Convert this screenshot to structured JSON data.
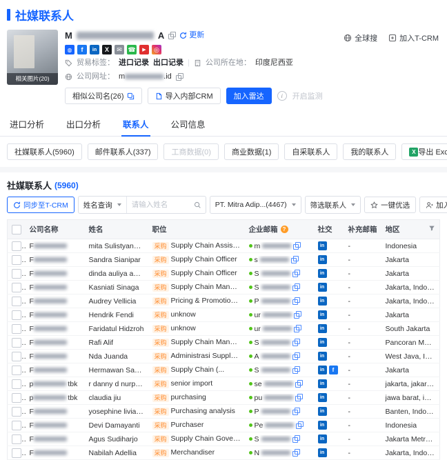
{
  "colors": {
    "primary": "#1665ff",
    "tag_orange": "#ff8a2b",
    "linkedin_blue": "#0a66c2",
    "facebook_blue": "#1877f2",
    "excel_green": "#21a366",
    "status_dot_green": "#52c41a"
  },
  "page": {
    "title": "社媒联系人"
  },
  "header_links": {
    "global_search": "全球搜",
    "join_tcrm": "加入T-CRM"
  },
  "company": {
    "name_prefix": "M",
    "name_suffix": "A",
    "refresh_label": "更新",
    "photo_caption": "相关图片(20)",
    "social_icons": [
      "website",
      "facebook",
      "linkedin",
      "x",
      "email",
      "phone",
      "youtube",
      "instagram"
    ],
    "trade_label": "贸易标签：",
    "import_record": "进口记录",
    "export_record": "出口记录",
    "location_label": "公司所在地：",
    "location_value": "印度尼西亚",
    "website_label": "公司网址：",
    "website_prefix": "m",
    "website_suffix": ".id",
    "similar_btn": "相似公司名(26)",
    "import_crm_btn": "导入内部CRM",
    "join_radar_btn": "加入雷达",
    "monitor_btn": "开启监测"
  },
  "tabs": [
    {
      "label": "进口分析",
      "active": false
    },
    {
      "label": "出口分析",
      "active": false
    },
    {
      "label": "联系人",
      "active": true
    },
    {
      "label": "公司信息",
      "active": false
    }
  ],
  "subtabs": [
    {
      "label": "社媒联系人(5960)",
      "disabled": false
    },
    {
      "label": "邮件联系人(337)",
      "disabled": false
    },
    {
      "label": "工商数据(0)",
      "disabled": true
    },
    {
      "label": "商业数据(1)",
      "disabled": false
    },
    {
      "label": "自采联系人",
      "disabled": false
    },
    {
      "label": "我的联系人",
      "disabled": false
    }
  ],
  "export_btn": {
    "label": "导出 Excel"
  },
  "section": {
    "title": "社媒联系人",
    "count": "(5960)"
  },
  "toolbar": {
    "sync_btn": "同步至T-CRM",
    "name_query": "姓名查询",
    "search_placeholder": "请输入姓名",
    "company_select": "PT. Mitra Adip...(4467)",
    "filter_select": "筛选联系人",
    "optimize_btn": "一键优选",
    "add_contacts_btn": "加入我的联系人"
  },
  "icons": {
    "info_glyph": "i",
    "help_glyph": "?",
    "linkedin_glyph": "in",
    "facebook_glyph": "f",
    "x_glyph": "X",
    "youtube_glyph": "▶",
    "instagram_glyph": "◎",
    "email_glyph": "✉",
    "phone_glyph": "☎",
    "excel_glyph": "X",
    "globe_glyph": "◍"
  },
  "table": {
    "tag": "采购",
    "headers": [
      "公司名称",
      "姓名",
      "职位",
      "企业邮箱",
      "社交",
      "补充邮箱",
      "地区"
    ],
    "rows": [
      {
        "company_prefix": "F",
        "company_suffix": "",
        "name": "mita Sulistyandari",
        "position": "Supply Chain Assistant Man...",
        "email_prefix": "m",
        "extra": "-",
        "region": "Indonesia",
        "socials": [
          "linkedin"
        ]
      },
      {
        "company_prefix": "F",
        "company_suffix": "",
        "name": "Sandra Sianipar",
        "position": "Supply Chain Officer",
        "email_prefix": "s",
        "extra": "-",
        "region": "Jakarta",
        "socials": [
          "linkedin"
        ]
      },
      {
        "company_prefix": "F",
        "company_suffix": "",
        "name": "dinda auliya adha",
        "position": "Supply Chain Officer",
        "email_prefix": "S",
        "extra": "-",
        "region": "Jakarta",
        "socials": [
          "linkedin"
        ]
      },
      {
        "company_prefix": "F",
        "company_suffix": "",
        "name": "Kasniati Sinaga",
        "position": "Supply Chain Management",
        "email_prefix": "S",
        "extra": "-",
        "region": "Jakarta, Indonesia",
        "socials": [
          "linkedin"
        ]
      },
      {
        "company_prefix": "F",
        "company_suffix": "",
        "name": "Audrey Vellicia",
        "position": "Pricing & Promotion Execut...",
        "email_prefix": "P",
        "extra": "-",
        "region": "Jakarta, Indonesia",
        "socials": [
          "linkedin"
        ]
      },
      {
        "company_prefix": "F",
        "company_suffix": "",
        "name": "Hendrik Fendi",
        "position": "unknow",
        "email_prefix": "ur",
        "extra": "-",
        "region": "Jakarta",
        "socials": [
          "linkedin"
        ]
      },
      {
        "company_prefix": "F",
        "company_suffix": "",
        "name": "Faridatul Hidzroh",
        "position": "unknow",
        "email_prefix": "ur",
        "extra": "-",
        "region": "South Jakarta",
        "socials": [
          "linkedin"
        ]
      },
      {
        "company_prefix": "F",
        "company_suffix": "",
        "name": "Rafi Alif",
        "position": "Supply Chain Management ...",
        "email_prefix": "S",
        "extra": "-",
        "region": "Pancoran Mas, ...",
        "socials": [
          "linkedin"
        ]
      },
      {
        "company_prefix": "F",
        "company_suffix": "",
        "name": "Nda Juanda",
        "position": "Administrasi Supply Chain (...",
        "email_prefix": "A",
        "extra": "-",
        "region": "West Java, Indo...",
        "socials": [
          "linkedin"
        ]
      },
      {
        "company_prefix": "F",
        "company_suffix": "",
        "name": "Hermawan Sapu...",
        "position": "Supply Chain (...",
        "email_prefix": "S",
        "extra": "-",
        "region": "Jakarta",
        "socials": [
          "linkedin",
          "facebook"
        ]
      },
      {
        "company_prefix": "p",
        "company_suffix": "tbk",
        "name": "r danny d nurpat...",
        "position": "senior import",
        "email_prefix": "se",
        "extra": "-",
        "region": "jakarta, jakarta t...",
        "socials": [
          "linkedin"
        ]
      },
      {
        "company_prefix": "p",
        "company_suffix": "tbk",
        "name": "claudia jiu",
        "position": "purchasing",
        "email_prefix": "pu",
        "extra": "-",
        "region": "jawa barat, indo...",
        "socials": [
          "linkedin"
        ]
      },
      {
        "company_prefix": "F",
        "company_suffix": "",
        "name": "yosephine liviane",
        "position": "Purchasing analysis",
        "email_prefix": "P",
        "extra": "-",
        "region": "Banten, Indonesia",
        "socials": [
          "linkedin"
        ]
      },
      {
        "company_prefix": "F",
        "company_suffix": "",
        "name": "Devi Damayanti",
        "position": "Purchaser",
        "email_prefix": "Pe",
        "extra": "-",
        "region": "Indonesia",
        "socials": [
          "linkedin"
        ]
      },
      {
        "company_prefix": "F",
        "company_suffix": "",
        "name": "Agus Sudiharjo",
        "position": "Supply Chain Governance In...",
        "email_prefix": "S",
        "extra": "-",
        "region": "Jakarta Metropo...",
        "socials": [
          "linkedin"
        ]
      },
      {
        "company_prefix": "F",
        "company_suffix": "",
        "name": "Nabilah Adellia",
        "position": "Merchandiser",
        "email_prefix": "N",
        "extra": "-",
        "region": "Jakarta, Indonesia",
        "socials": [
          "linkedin"
        ]
      }
    ]
  }
}
